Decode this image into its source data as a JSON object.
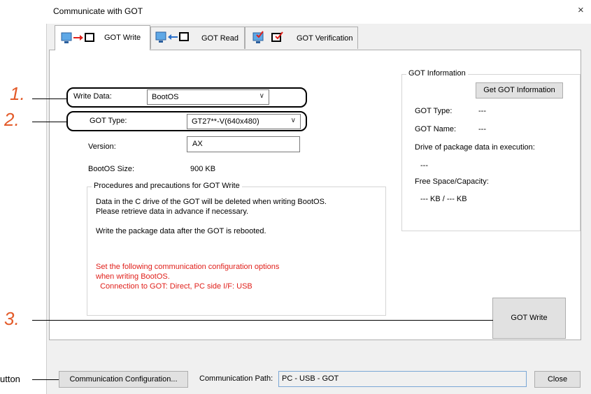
{
  "window": {
    "title": "Communicate with GOT",
    "close": "×"
  },
  "tabs": [
    {
      "label": "GOT Write",
      "active": true
    },
    {
      "label": "GOT Read"
    },
    {
      "label": "GOT Verification"
    }
  ],
  "form": {
    "write_data_label": "Write Data:",
    "write_data_value": "BootOS",
    "got_type_label": "GOT Type:",
    "got_type_value": "GT27**-V(640x480)",
    "version_label": "Version:",
    "version_value": "AX",
    "bootos_size_label": "BootOS Size:",
    "bootos_size_value": "900 KB"
  },
  "procedures": {
    "legend": "Procedures and precautions for GOT Write",
    "line1": "Data in the C drive of the GOT will be deleted when writing BootOS.",
    "line2": "Please retrieve data in advance if necessary.",
    "line3": "Write the package data after the GOT is rebooted.",
    "red1": "Set the following communication configuration options",
    "red2": "when writing BootOS.",
    "red3": "  Connection to GOT: Direct, PC side I/F: USB"
  },
  "got_info": {
    "legend": "GOT Information",
    "get_button": "Get GOT Information",
    "type_label": "GOT Type:",
    "type_value": "---",
    "name_label": "GOT Name:",
    "name_value": "---",
    "drive_label": "Drive of package data in execution:",
    "drive_value": "---",
    "free_label": "Free Space/Capacity:",
    "free_value": "--- KB / --- KB"
  },
  "buttons": {
    "got_write": "GOT Write",
    "close": "Close",
    "comm_config": "Communication Configuration..."
  },
  "status": {
    "comm_path_label": "Communication Path:",
    "comm_path_value": "PC - USB - GOT"
  },
  "annotations": {
    "n1": "1.",
    "n2": "2.",
    "n3": "3.",
    "left_text": "utton"
  },
  "colors": {
    "accent_number": "#e35b2a",
    "warning_text": "#e0201b",
    "path_field_border": "#7aa7d6"
  }
}
